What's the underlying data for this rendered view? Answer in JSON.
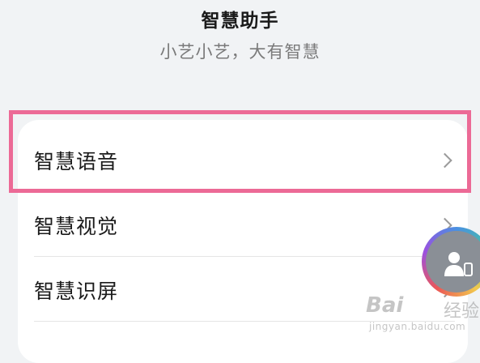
{
  "header": {
    "title": "智慧助手",
    "subtitle": "小艺小艺，大有智慧"
  },
  "menu": {
    "items": [
      {
        "label": "智慧语音"
      },
      {
        "label": "智慧视觉"
      },
      {
        "label": "智慧识屏"
      }
    ]
  },
  "floating_button": {
    "icon": "assistant-person-icon"
  },
  "watermark": {
    "logo": "Bai",
    "tail": "经验",
    "url": "jingyan.baidu.com"
  },
  "colors": {
    "background": "#f1f3f5",
    "card": "#ffffff",
    "highlight": "#ec6a96",
    "text_primary": "#1b1b1b",
    "text_secondary": "#7a7a7a",
    "chevron": "#9a9a9a"
  }
}
